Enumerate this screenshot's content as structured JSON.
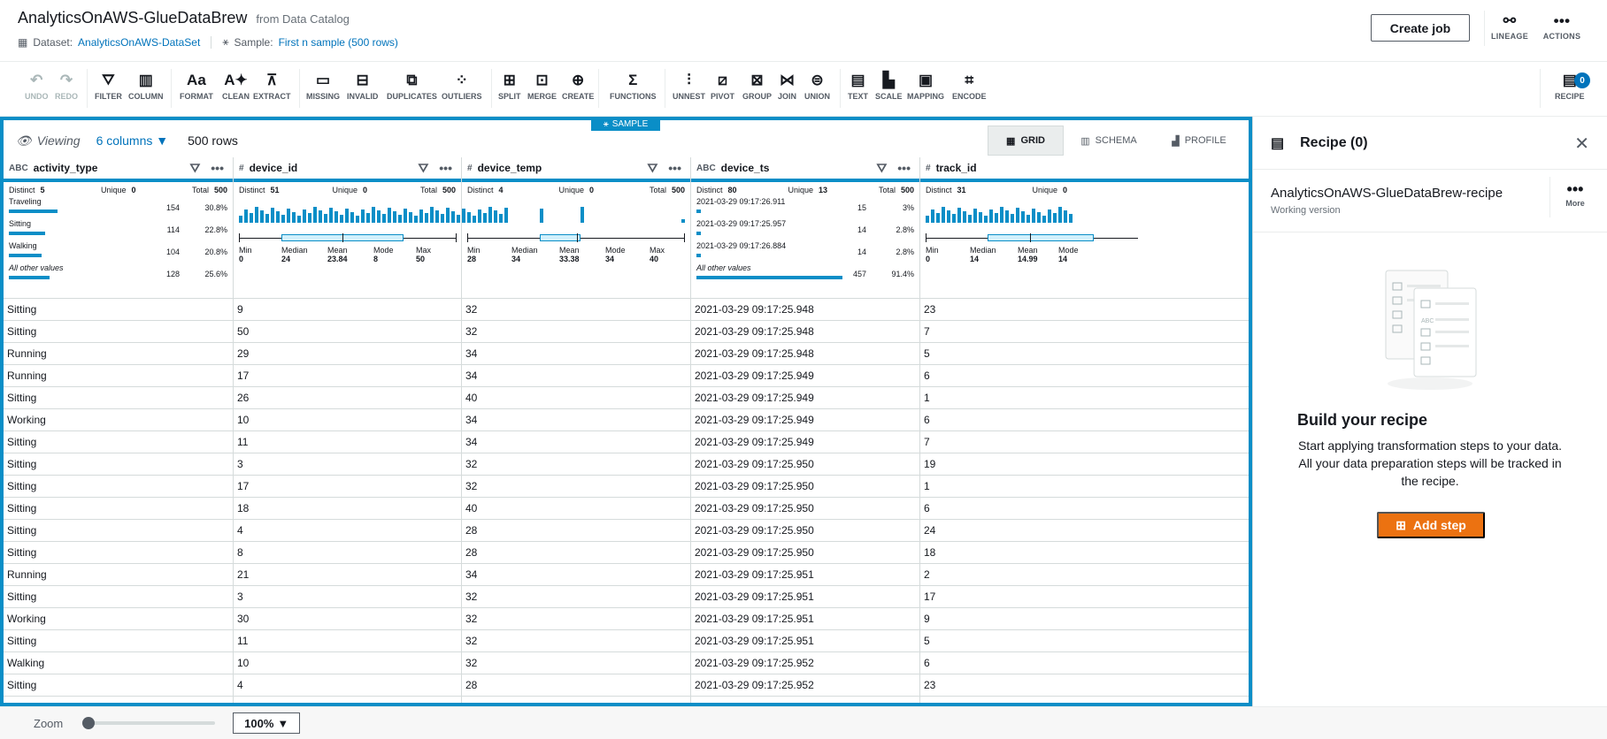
{
  "header": {
    "title": "AnalyticsOnAWS-GlueDataBrew",
    "subtitle": "from Data Catalog",
    "dataset_label": "Dataset:",
    "dataset_value": "AnalyticsOnAWS-DataSet",
    "sample_label": "Sample:",
    "sample_value": "First n sample (500 rows)",
    "create_job": "Create job",
    "lineage": "LINEAGE",
    "actions": "ACTIONS"
  },
  "toolbar": {
    "undo": "UNDO",
    "redo": "REDO",
    "filter": "FILTER",
    "column": "COLUMN",
    "format": "FORMAT",
    "clean": "CLEAN",
    "extract": "EXTRACT",
    "missing": "MISSING",
    "invalid": "INVALID",
    "duplicates": "DUPLICATES",
    "outliers": "OUTLIERS",
    "split": "SPLIT",
    "merge": "MERGE",
    "create": "CREATE",
    "functions": "FUNCTIONS",
    "unnest": "UNNEST",
    "pivot": "PIVOT",
    "group": "GROUP",
    "join": "JOIN",
    "union": "UNION",
    "text": "TEXT",
    "scale": "SCALE",
    "mapping": "MAPPING",
    "encode": "ENCODE",
    "recipe": "RECIPE",
    "recipe_count": "0"
  },
  "grid": {
    "sample_tag": "SAMPLE",
    "viewing": "Viewing",
    "columns_sel": "6 columns",
    "rows": "500 rows",
    "tab_grid": "GRID",
    "tab_schema": "SCHEMA",
    "tab_profile": "PROFILE",
    "distinct_label": "Distinct",
    "unique_label": "Unique",
    "total_label": "Total",
    "min_label": "Min",
    "median_label": "Median",
    "mean_label": "Mean",
    "mode_label": "Mode",
    "max_label": "Max",
    "columns": {
      "activity_type": {
        "name": "activity_type",
        "type": "ABC",
        "distinct": "5",
        "unique": "0",
        "total": "500",
        "values": [
          {
            "label": "Traveling",
            "count": "154",
            "pct": "30.8%",
            "frac": 0.308
          },
          {
            "label": "Sitting",
            "count": "114",
            "pct": "22.8%",
            "frac": 0.228
          },
          {
            "label": "Walking",
            "count": "104",
            "pct": "20.8%",
            "frac": 0.208
          },
          {
            "label": "All other values",
            "count": "128",
            "pct": "25.6%",
            "frac": 0.256
          }
        ]
      },
      "device_id": {
        "name": "device_id",
        "type": "#",
        "distinct": "51",
        "unique": "0",
        "total": "500",
        "min": "0",
        "median": "24",
        "mean": "23.84",
        "mode": "8",
        "max": "50"
      },
      "device_temp": {
        "name": "device_temp",
        "type": "#",
        "distinct": "4",
        "unique": "0",
        "total": "500",
        "min": "28",
        "median": "34",
        "mean": "33.38",
        "mode": "34",
        "max": "40"
      },
      "device_ts": {
        "name": "device_ts",
        "type": "ABC",
        "distinct": "80",
        "unique": "13",
        "total": "500",
        "values": [
          {
            "label": "2021-03-29 09:17:26.911",
            "count": "15",
            "pct": "3%",
            "frac": 0.03
          },
          {
            "label": "2021-03-29 09:17:25.957",
            "count": "14",
            "pct": "2.8%",
            "frac": 0.028
          },
          {
            "label": "2021-03-29 09:17:26.884",
            "count": "14",
            "pct": "2.8%",
            "frac": 0.028
          },
          {
            "label": "All other values",
            "count": "457",
            "pct": "91.4%",
            "frac": 0.914
          }
        ]
      },
      "track_id": {
        "name": "track_id",
        "type": "#",
        "distinct": "31",
        "unique": "0",
        "min": "0",
        "median": "14",
        "mean": "14.99",
        "mode": "14"
      }
    },
    "rows_data": [
      [
        "Sitting",
        "9",
        "32",
        "2021-03-29 09:17:25.948",
        "23"
      ],
      [
        "Sitting",
        "50",
        "32",
        "2021-03-29 09:17:25.948",
        "7"
      ],
      [
        "Running",
        "29",
        "34",
        "2021-03-29 09:17:25.948",
        "5"
      ],
      [
        "Running",
        "17",
        "34",
        "2021-03-29 09:17:25.949",
        "6"
      ],
      [
        "Sitting",
        "26",
        "40",
        "2021-03-29 09:17:25.949",
        "1"
      ],
      [
        "Working",
        "10",
        "34",
        "2021-03-29 09:17:25.949",
        "6"
      ],
      [
        "Sitting",
        "11",
        "34",
        "2021-03-29 09:17:25.949",
        "7"
      ],
      [
        "Sitting",
        "3",
        "32",
        "2021-03-29 09:17:25.950",
        "19"
      ],
      [
        "Sitting",
        "17",
        "32",
        "2021-03-29 09:17:25.950",
        "1"
      ],
      [
        "Sitting",
        "18",
        "40",
        "2021-03-29 09:17:25.950",
        "6"
      ],
      [
        "Sitting",
        "4",
        "28",
        "2021-03-29 09:17:25.950",
        "24"
      ],
      [
        "Sitting",
        "8",
        "28",
        "2021-03-29 09:17:25.950",
        "18"
      ],
      [
        "Running",
        "21",
        "34",
        "2021-03-29 09:17:25.951",
        "2"
      ],
      [
        "Sitting",
        "3",
        "32",
        "2021-03-29 09:17:25.951",
        "17"
      ],
      [
        "Working",
        "30",
        "32",
        "2021-03-29 09:17:25.951",
        "9"
      ],
      [
        "Sitting",
        "11",
        "32",
        "2021-03-29 09:17:25.951",
        "5"
      ],
      [
        "Walking",
        "10",
        "32",
        "2021-03-29 09:17:25.952",
        "6"
      ],
      [
        "Sitting",
        "4",
        "28",
        "2021-03-29 09:17:25.952",
        "23"
      ]
    ]
  },
  "recipe": {
    "title": "Recipe (0)",
    "name": "AnalyticsOnAWS-GlueDataBrew-recipe",
    "version": "Working version",
    "more": "More",
    "build_title": "Build your recipe",
    "build_desc": "Start applying transformation steps to your data. All your data preparation steps will be tracked in the recipe.",
    "add_step": "Add step"
  },
  "footer": {
    "zoom_label": "Zoom",
    "zoom_value": "100%",
    "zoom_level": 0.0
  },
  "colors": {
    "accent": "#0a8ec7",
    "link": "#0073bb",
    "primary_button": "#ec7211"
  }
}
